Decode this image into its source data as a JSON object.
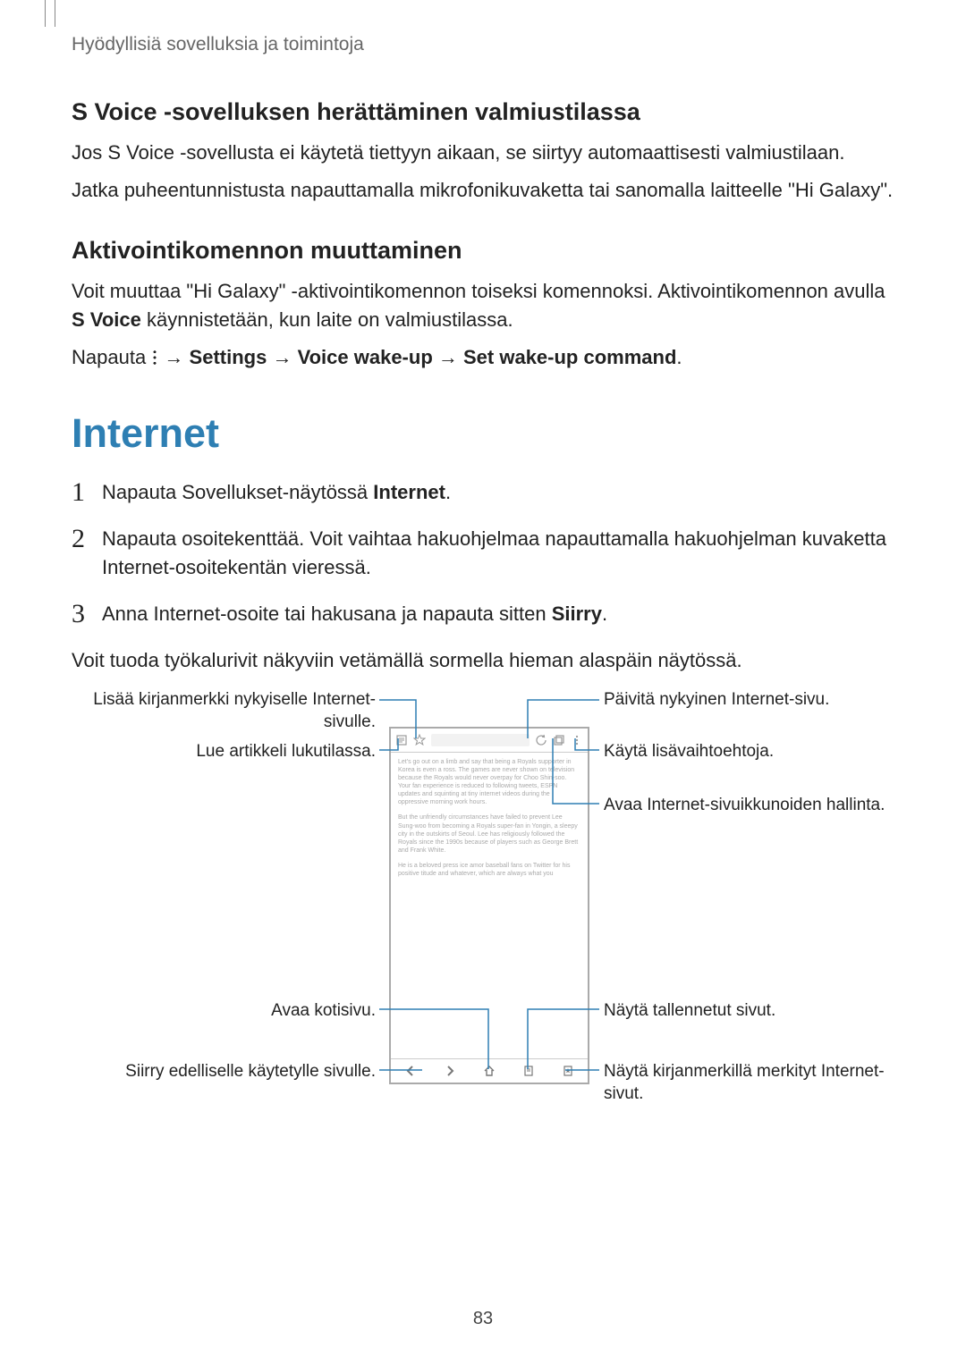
{
  "running_head": "Hyödyllisiä sovelluksia ja toimintoja",
  "svoice": {
    "heading": "S Voice -sovelluksen herättäminen valmiustilassa",
    "p1": "Jos S Voice -sovellusta ei käytetä tiettyyn aikaan, se siirtyy automaattisesti valmiustilaan.",
    "p2": "Jatka puheentunnistusta napauttamalla mikrofonikuvaketta tai sanomalla laitteelle \"Hi Galaxy\"."
  },
  "wake": {
    "heading": "Aktivointikomennon muuttaminen",
    "p1a": "Voit muuttaa \"Hi Galaxy\" -aktivointikomennon toiseksi komennoksi. Aktivointikomennon avulla ",
    "p1b": "S Voice",
    "p1c": " käynnistetään, kun laite on valmiustilassa.",
    "p2a": "Napauta ",
    "p2b": " → ",
    "p2c": "Settings",
    "p2d": " → ",
    "p2e": "Voice wake-up",
    "p2f": " → ",
    "p2g": "Set wake-up command",
    "p2h": "."
  },
  "internet": {
    "title": "Internet",
    "step1a": "Napauta Sovellukset-näytössä ",
    "step1b": "Internet",
    "step1c": ".",
    "step2": "Napauta osoitekenttää. Voit vaihtaa hakuohjelmaa napauttamalla hakuohjelman kuvaketta Internet-osoitekentän vieressä.",
    "step3a": "Anna Internet-osoite tai hakusana ja napauta sitten ",
    "step3b": "Siirry",
    "step3c": ".",
    "after": "Voit tuoda työkalurivit näkyviin vetämällä sormella hieman alaspäin näytössä."
  },
  "callouts": {
    "l1": "Lisää kirjanmerkki nykyiselle Internet-sivulle.",
    "l2": "Lue artikkeli lukutilassa.",
    "l3": "Avaa kotisivu.",
    "l4": "Siirry edelliselle käytetylle sivulle.",
    "r1": "Päivitä nykyinen Internet-sivu.",
    "r2": "Käytä lisävaihtoehtoja.",
    "r3": "Avaa Internet-sivuikkunoiden hallinta.",
    "r4": "Näytä tallennetut sivut.",
    "r5": "Näytä kirjanmerkillä merkityt Internet-sivut."
  },
  "page_number": "83"
}
